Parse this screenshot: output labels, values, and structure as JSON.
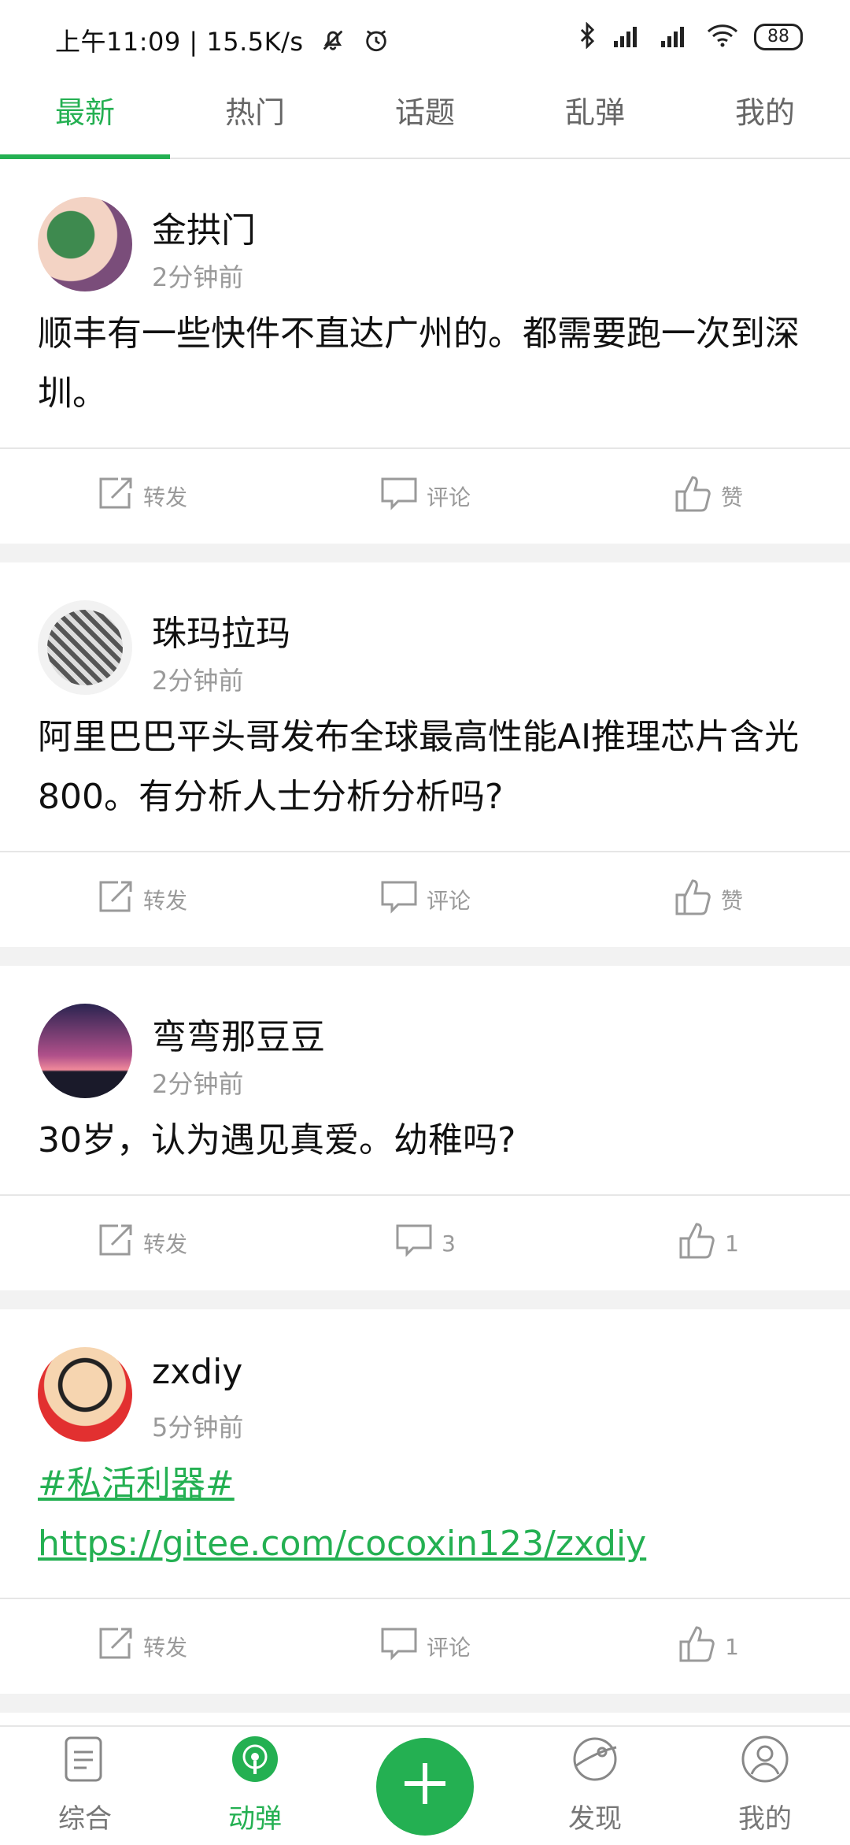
{
  "status_bar": {
    "time_text": "上午11:09 | 15.5K/s",
    "battery": "88"
  },
  "tabs": [
    {
      "label": "最新",
      "active": true
    },
    {
      "label": "热门"
    },
    {
      "label": "话题"
    },
    {
      "label": "乱弹"
    },
    {
      "label": "我的"
    }
  ],
  "posts": [
    {
      "username": "金拱门",
      "time": "2分钟前",
      "content": "顺丰有一些快件不直达广州的。都需要跑一次到深圳。",
      "forward": "转发",
      "comment": "评论",
      "like": "赞"
    },
    {
      "username": "珠玛拉玛",
      "time": "2分钟前",
      "content": "阿里巴巴平头哥发布全球最高性能AI推理芯片含光800。有分析人士分析分析吗?",
      "forward": "转发",
      "comment": "评论",
      "like": "赞"
    },
    {
      "username": "弯弯那豆豆",
      "time": "2分钟前",
      "content": "30岁，认为遇见真爱。幼稚吗?",
      "forward": "转发",
      "comment": "3",
      "like": "1"
    },
    {
      "username": "zxdiy",
      "time": "5分钟前",
      "content_link1": "#私活利器#",
      "content_link2": "https://gitee.com/cocoxin123/zxdiy",
      "forward": "转发",
      "comment": "评论",
      "like": "1"
    }
  ],
  "bottom_nav": [
    {
      "label": "综合",
      "icon": "document-icon"
    },
    {
      "label": "动弹",
      "icon": "broadcast-icon",
      "active": true
    },
    {
      "label": "",
      "icon": "plus-icon"
    },
    {
      "label": "发现",
      "icon": "planet-icon"
    },
    {
      "label": "我的",
      "icon": "profile-icon"
    }
  ],
  "colors": {
    "accent": "#24b052",
    "muted": "#9a9a9a",
    "divider": "#e6e6e6"
  }
}
